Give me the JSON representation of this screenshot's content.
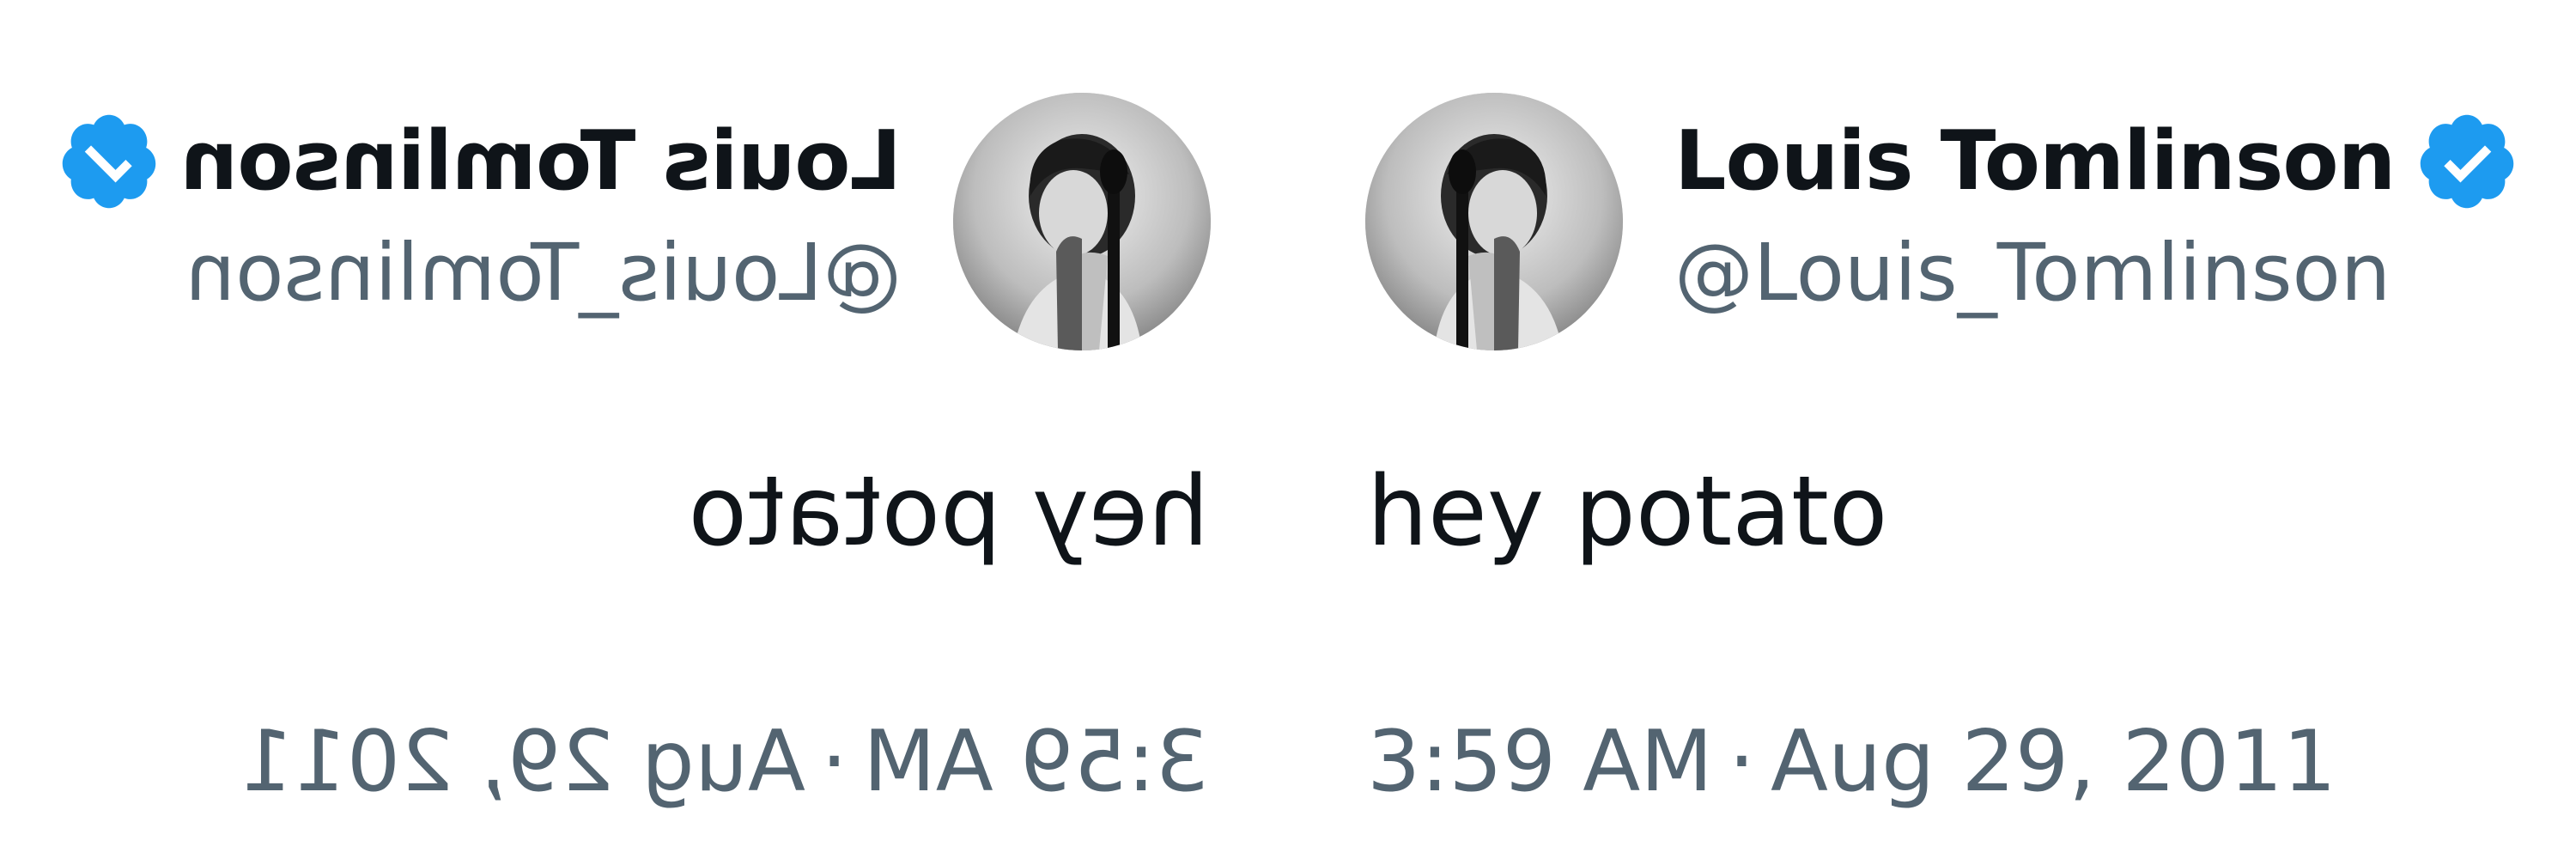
{
  "tweet": {
    "display_name": "Louis Tomlinson",
    "handle": "@Louis_Tomlinson",
    "text": "hey potato",
    "time": "3:59 AM",
    "separator": "·",
    "date": "Aug 29, 2011",
    "verified": true
  },
  "icons": {
    "verified": "verified-badge-icon",
    "avatar": "profile-photo"
  },
  "colors": {
    "verified_blue": "#1d9bf0",
    "name_text": "#0f1419",
    "secondary_text": "#536471",
    "background": "#ffffff"
  }
}
